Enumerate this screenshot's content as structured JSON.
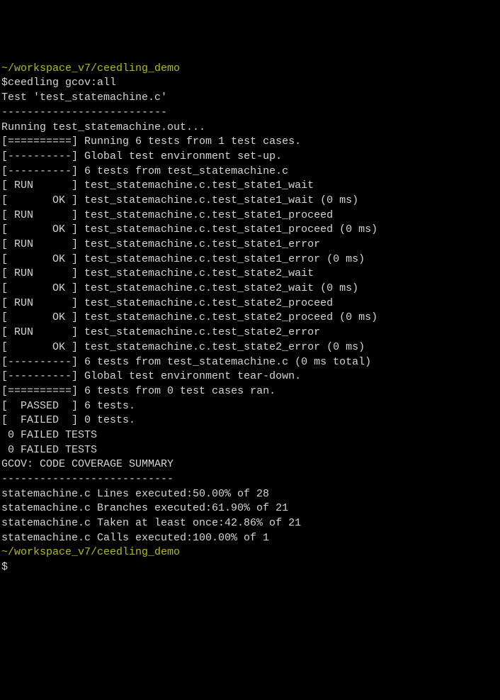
{
  "prompt_path": "~/workspace_v7/ceedling_demo",
  "command": "ceedling gcov:all",
  "blank": "",
  "test_header": "Test 'test_statemachine.c'",
  "dashes_test": "--------------------------",
  "running_out": "Running test_statemachine.out...",
  "lines": [
    {
      "tag": "[==========]",
      "text": " Running 6 tests from 1 test cases."
    },
    {
      "tag": "[----------]",
      "text": " Global test environment set-up."
    },
    {
      "tag": "[----------]",
      "text": " 6 tests from test_statemachine.c"
    },
    {
      "tag": "[ RUN      ]",
      "text": " test_statemachine.c.test_state1_wait"
    },
    {
      "tag": "[       OK ]",
      "text": " test_statemachine.c.test_state1_wait (0 ms)"
    },
    {
      "tag": "[ RUN      ]",
      "text": " test_statemachine.c.test_state1_proceed"
    },
    {
      "tag": "[       OK ]",
      "text": " test_statemachine.c.test_state1_proceed (0 ms)"
    },
    {
      "tag": "[ RUN      ]",
      "text": " test_statemachine.c.test_state1_error"
    },
    {
      "tag": "[       OK ]",
      "text": " test_statemachine.c.test_state1_error (0 ms)"
    },
    {
      "tag": "[ RUN      ]",
      "text": " test_statemachine.c.test_state2_wait"
    },
    {
      "tag": "[       OK ]",
      "text": " test_statemachine.c.test_state2_wait (0 ms)"
    },
    {
      "tag": "[ RUN      ]",
      "text": " test_statemachine.c.test_state2_proceed"
    },
    {
      "tag": "[       OK ]",
      "text": " test_statemachine.c.test_state2_proceed (0 ms)"
    },
    {
      "tag": "[ RUN      ]",
      "text": " test_statemachine.c.test_state2_error"
    },
    {
      "tag": "[       OK ]",
      "text": " test_statemachine.c.test_state2_error (0 ms)"
    },
    {
      "tag": "[----------]",
      "text": " 6 tests from test_statemachine.c (0 ms total)"
    }
  ],
  "teardown": [
    {
      "tag": "[----------]",
      "text": " Global test environment tear-down."
    },
    {
      "tag": "[==========]",
      "text": " 6 tests from 0 test cases ran."
    }
  ],
  "passed_tag": "[  PASSED  ]",
  "passed_text": " 6 tests.",
  "failed_tag": "[  FAILED  ]",
  "failed_text": " 0 tests.",
  "zero_failed": " 0 FAILED TESTS",
  "gcov_header": "GCOV: CODE COVERAGE SUMMARY",
  "gcov_dashes": "---------------------------",
  "gcov_lines": [
    "statemachine.c Lines executed:50.00% of 28",
    "statemachine.c Branches executed:61.90% of 21",
    "statemachine.c Taken at least once:42.86% of 21",
    "statemachine.c Calls executed:100.00% of 1"
  ],
  "dollar": "$"
}
